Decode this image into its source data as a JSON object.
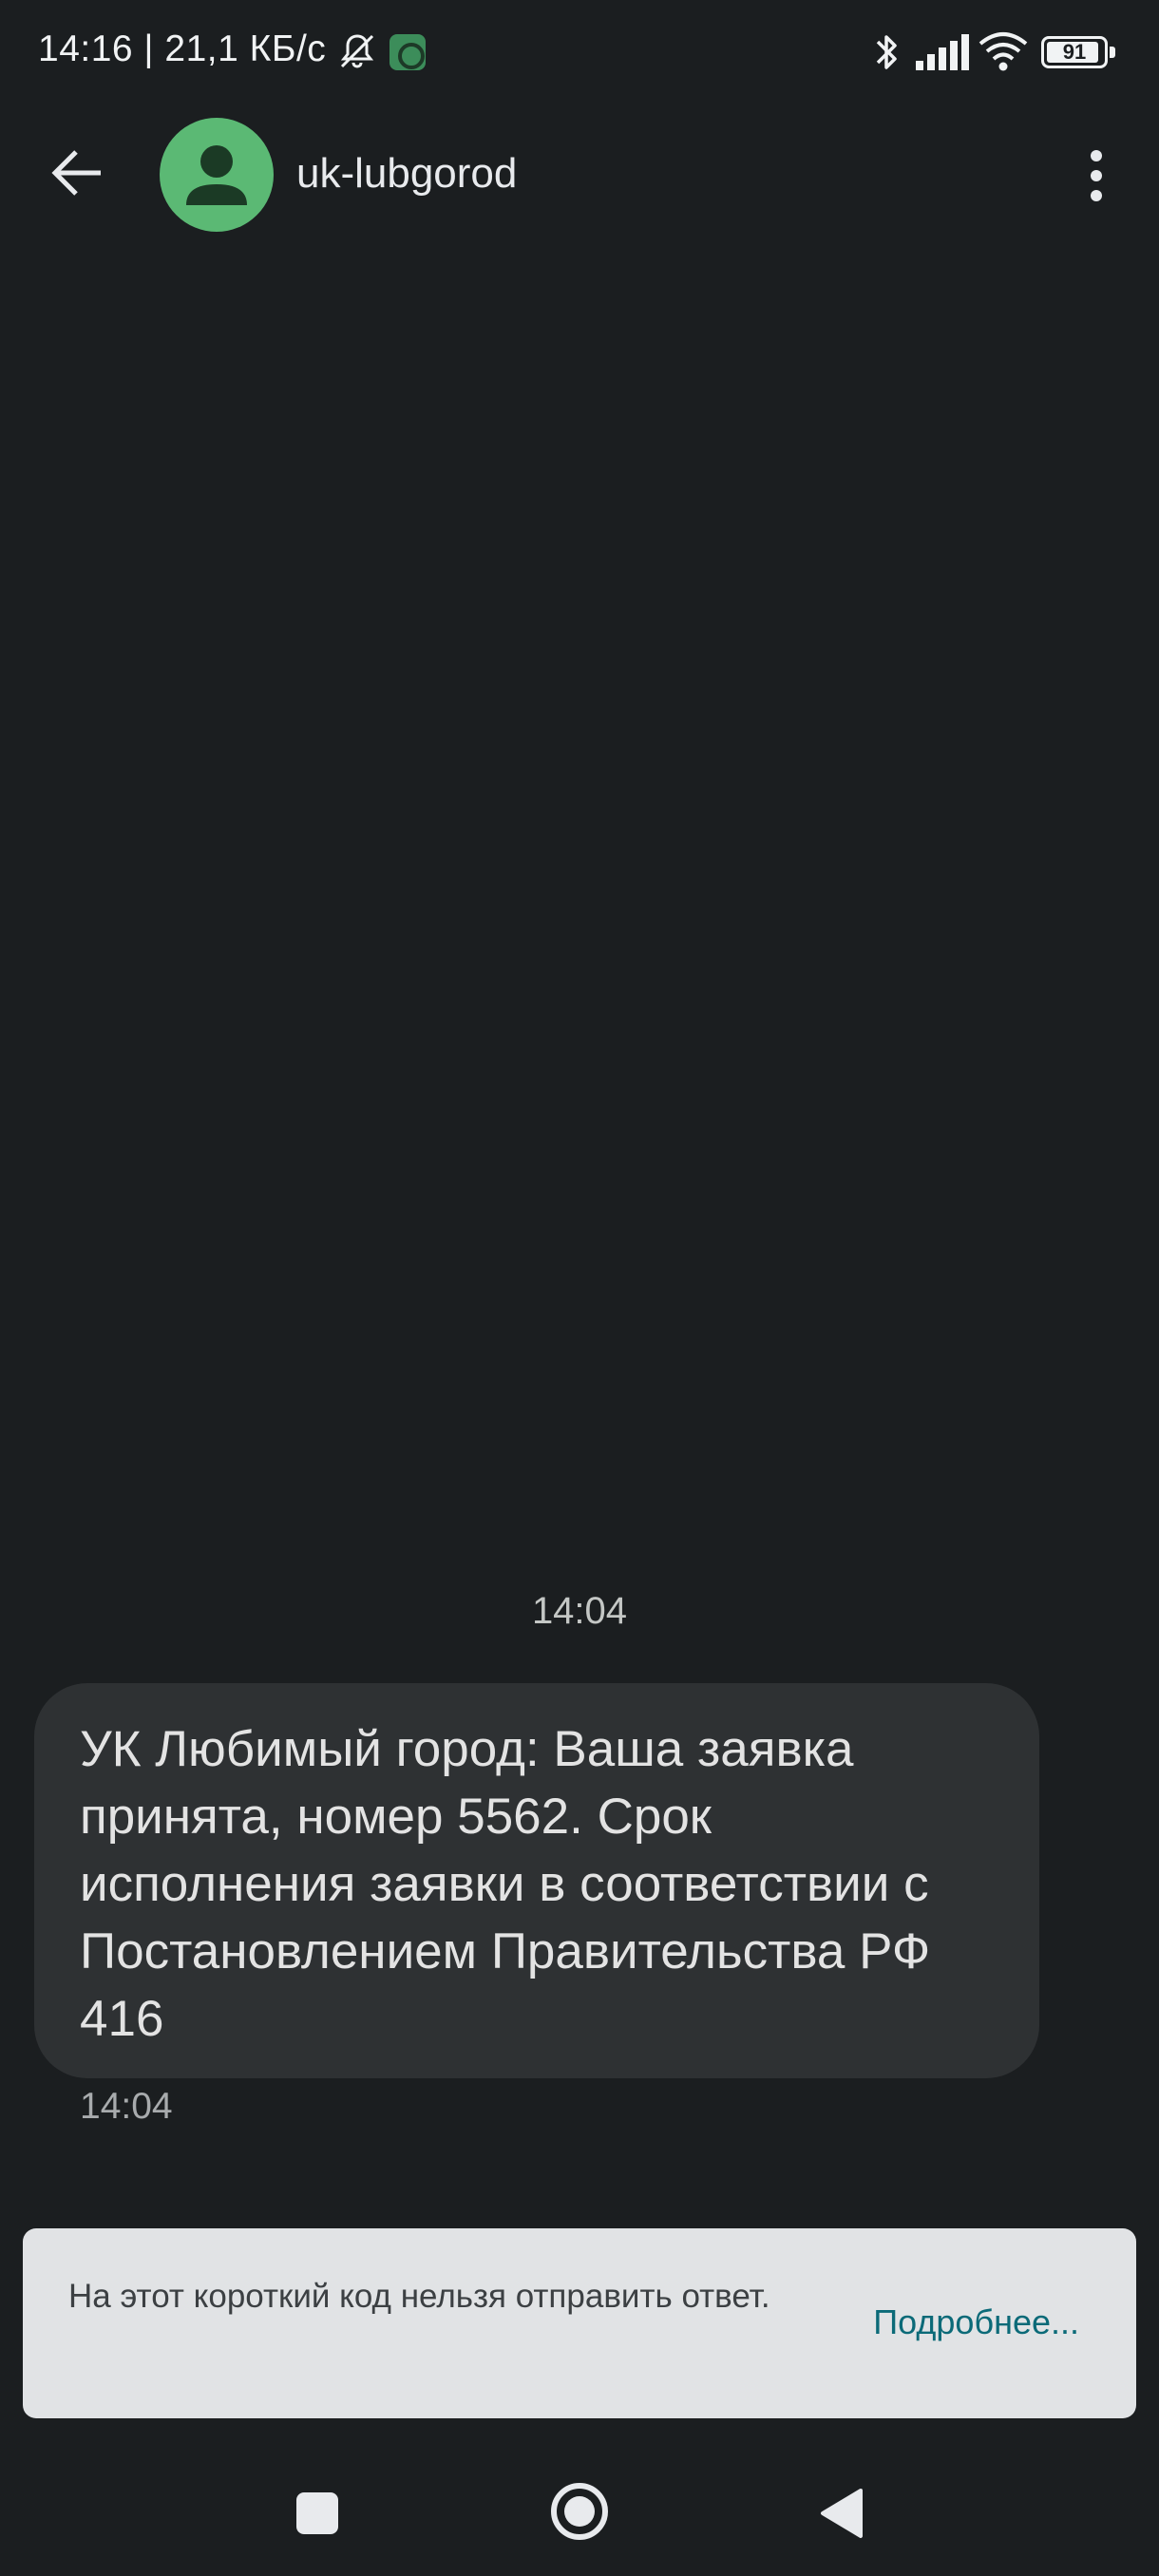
{
  "status_bar": {
    "text": "14:16 | 21,1 КБ/с",
    "battery_level": "91",
    "icons": [
      "bell-muted-icon",
      "app-notification-icon",
      "bluetooth-icon",
      "signal-icon",
      "wifi-icon",
      "battery-icon"
    ]
  },
  "app_bar": {
    "contact_name": "uk-lubgorod",
    "avatar_color": "#5bb974",
    "icons": [
      "back-arrow-icon",
      "person-icon",
      "more-vert-icon"
    ]
  },
  "conversation": {
    "date_header": "14:04",
    "messages": [
      {
        "text": "УК Любимый город: Ваша заявка принята, номер 5562. Срок исполнения заявки в соответствии с Постановлением Правительства РФ 416",
        "time": "14:04"
      }
    ]
  },
  "info_banner": {
    "text": "На этот короткий код нельзя отправить ответ.",
    "link_label": "Подробнее..."
  },
  "nav_bar": {
    "icons": [
      "recents-icon",
      "home-icon",
      "back-icon"
    ]
  },
  "colors": {
    "background": "#1b1e20",
    "bubble": "#2e3133",
    "banner": "#e1e3e5",
    "link": "#0b6a78"
  }
}
